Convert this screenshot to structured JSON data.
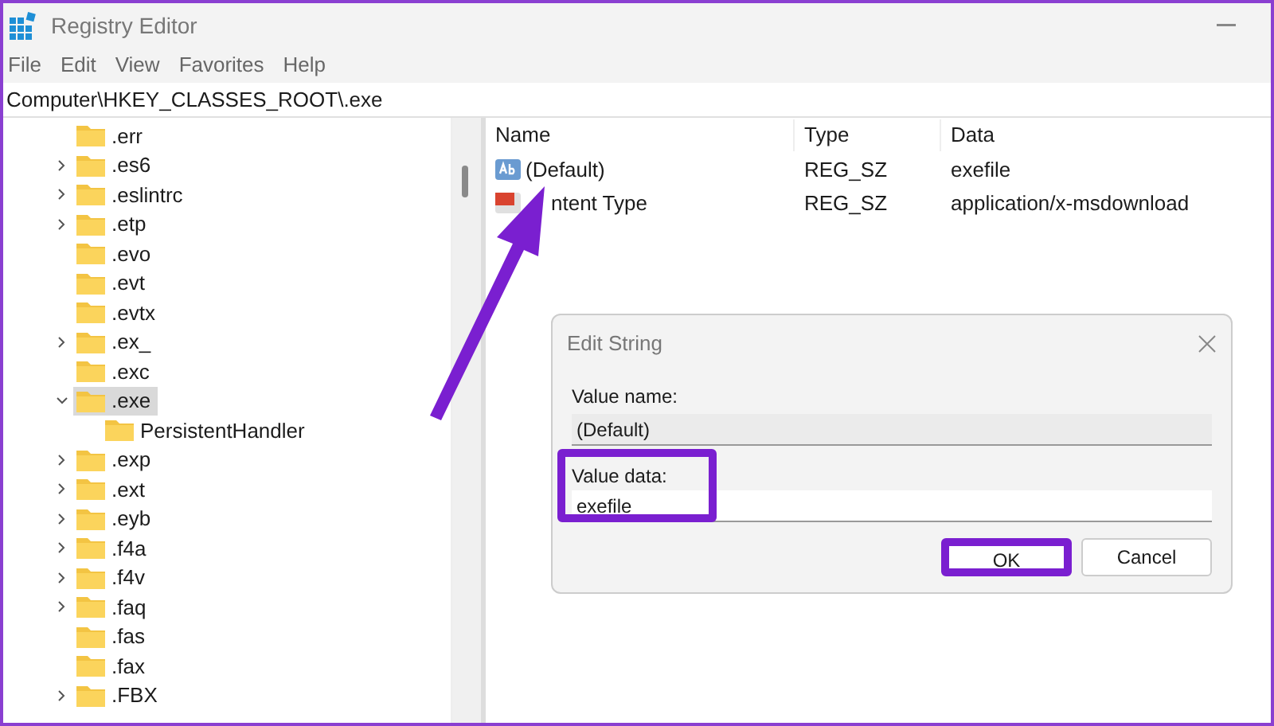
{
  "window": {
    "title": "Registry Editor"
  },
  "menu": [
    "File",
    "Edit",
    "View",
    "Favorites",
    "Help"
  ],
  "address": "Computer\\HKEY_CLASSES_ROOT\\.exe",
  "tree": [
    {
      "label": ".err",
      "expandable": false,
      "selected": false
    },
    {
      "label": ".es6",
      "expandable": true,
      "expanded": false,
      "selected": false
    },
    {
      "label": ".eslintrc",
      "expandable": true,
      "expanded": false,
      "selected": false
    },
    {
      "label": ".etp",
      "expandable": true,
      "expanded": false,
      "selected": false
    },
    {
      "label": ".evo",
      "expandable": false,
      "selected": false
    },
    {
      "label": ".evt",
      "expandable": false,
      "selected": false
    },
    {
      "label": ".evtx",
      "expandable": false,
      "selected": false
    },
    {
      "label": ".ex_",
      "expandable": true,
      "expanded": false,
      "selected": false
    },
    {
      "label": ".exc",
      "expandable": false,
      "selected": false
    },
    {
      "label": ".exe",
      "expandable": true,
      "expanded": true,
      "selected": true,
      "children": [
        {
          "label": "PersistentHandler",
          "expandable": false,
          "selected": false
        }
      ]
    },
    {
      "label": ".exp",
      "expandable": true,
      "expanded": false,
      "selected": false
    },
    {
      "label": ".ext",
      "expandable": true,
      "expanded": false,
      "selected": false
    },
    {
      "label": ".eyb",
      "expandable": true,
      "expanded": false,
      "selected": false
    },
    {
      "label": ".f4a",
      "expandable": true,
      "expanded": false,
      "selected": false
    },
    {
      "label": ".f4v",
      "expandable": true,
      "expanded": false,
      "selected": false
    },
    {
      "label": ".faq",
      "expandable": true,
      "expanded": false,
      "selected": false
    },
    {
      "label": ".fas",
      "expandable": false,
      "selected": false
    },
    {
      "label": ".fax",
      "expandable": false,
      "selected": false
    },
    {
      "label": ".FBX",
      "expandable": true,
      "expanded": false,
      "selected": false
    }
  ],
  "table": {
    "columns": [
      "Name",
      "Type",
      "Data"
    ],
    "rows": [
      {
        "kind": "string",
        "name": "(Default)",
        "type": "REG_SZ",
        "data": "exefile"
      },
      {
        "kind": "binary",
        "name": "ntent Type",
        "type": "REG_SZ",
        "data": "application/x-msdownload"
      }
    ]
  },
  "dialog": {
    "title": "Edit String",
    "value_name_label": "Value name:",
    "value_name": "(Default)",
    "value_data_label": "Value data:",
    "value_data": "exefile",
    "buttons": [
      {
        "label": "OK",
        "highlighted": true
      },
      {
        "label": "Cancel",
        "highlighted": false
      }
    ]
  }
}
